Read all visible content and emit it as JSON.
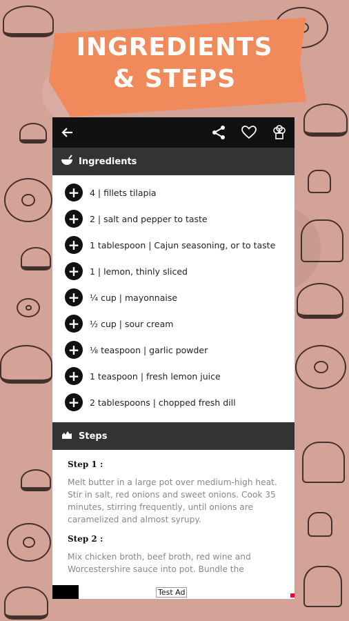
{
  "banner": {
    "line1": "INGREDIENTS",
    "line2": "& STEPS"
  },
  "appbar": {
    "back_icon": "arrow-left-icon",
    "actions": [
      "share-icon",
      "heart-icon",
      "chef-hat-icon"
    ]
  },
  "ingredients": {
    "header": "Ingredients",
    "items": [
      "4 | fillets tilapia",
      "2 | salt and pepper to taste",
      "1 tablespoon | Cajun seasoning, or to taste",
      "1 | lemon, thinly sliced",
      "¼ cup | mayonnaise",
      "½ cup | sour cream",
      "⅛ teaspoon | garlic powder",
      "1 teaspoon | fresh lemon juice",
      "2 tablespoons | chopped fresh dill"
    ]
  },
  "steps": {
    "header": "Steps",
    "items": [
      {
        "title": "Step 1 :",
        "body": "Melt butter in a large pot over medium-high heat. Stir in salt, red onions and sweet onions. Cook 35 minutes, stirring frequently, until onions are caramelized and almost syrupy."
      },
      {
        "title": "Step 2 :",
        "body": "Mix chicken broth, beef broth, red wine and Worcestershire sauce into pot. Bundle the"
      }
    ]
  },
  "ad": {
    "label": "Test Ad"
  }
}
